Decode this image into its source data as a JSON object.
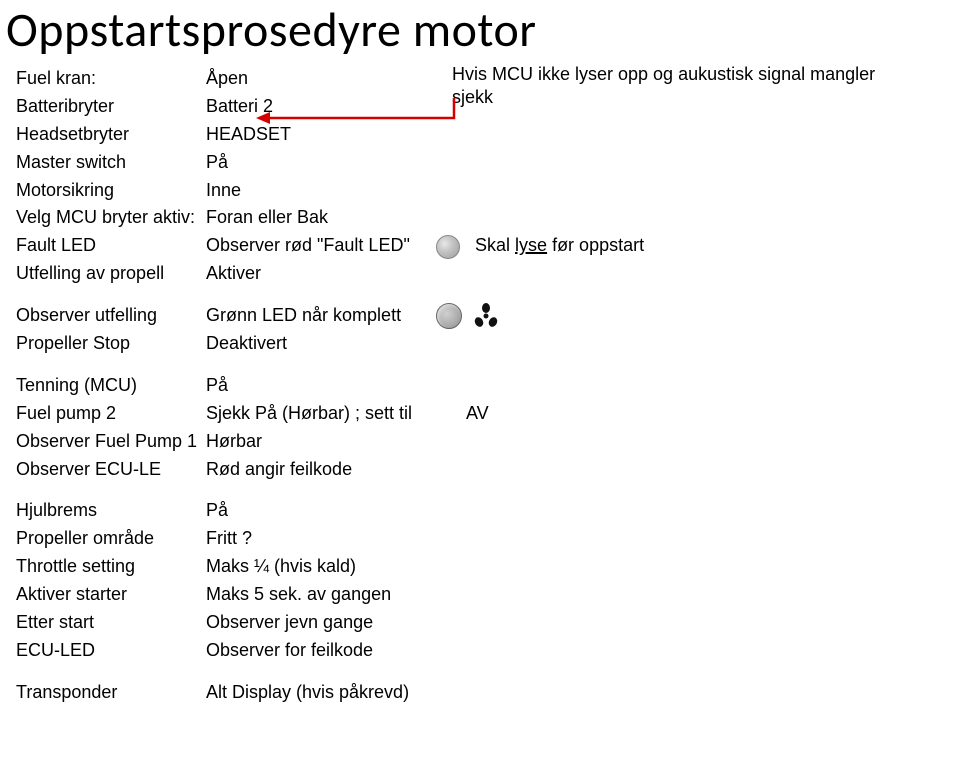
{
  "title": "Oppstartsprosedyre motor",
  "annotation": {
    "line1": "Hvis MCU  ikke lyser opp  og aukustisk signal mangler",
    "line2": "sjekk"
  },
  "group1": [
    {
      "label": "Fuel kran:",
      "value": "Åpen",
      "note": ""
    },
    {
      "label": "Batteribryter",
      "value": "Batteri 2",
      "note": ""
    },
    {
      "label": "Headsetbryter",
      "value": "HEADSET",
      "note": ""
    },
    {
      "label": "Master switch",
      "value": "På",
      "note": ""
    },
    {
      "label": "Motorsikring",
      "value": "Inne",
      "note": ""
    },
    {
      "label": "Velg MCU bryter aktiv:",
      "value": "Foran eller Bak",
      "note": ""
    },
    {
      "label": "Fault LED",
      "value": "Observer rød \"Fault LED\"",
      "note_prefix": "Skal ",
      "note_underline": "lyse",
      "note_suffix": " før oppstart"
    },
    {
      "label": "Utfelling av propell",
      "value": "Aktiver",
      "note": ""
    }
  ],
  "group2": [
    {
      "label": "Observer utfelling",
      "value": "Grønn LED når komplett"
    },
    {
      "label": "Propeller Stop",
      "value": "Deaktivert"
    }
  ],
  "group3": [
    {
      "label": "Tenning (MCU)",
      "value": "På",
      "note": ""
    },
    {
      "label": "Fuel pump 2",
      "value": "Sjekk På (Hørbar) ; sett til",
      "note": "AV"
    },
    {
      "label": "Observer Fuel Pump 1",
      "value": "Hørbar",
      "note": ""
    },
    {
      "label": "Observer ECU-LE",
      "value": "Rød angir feilkode",
      "note": ""
    }
  ],
  "group4": [
    {
      "label": "Hjulbrems",
      "value": "På"
    },
    {
      "label": "Propeller område",
      "value": "Fritt ?"
    },
    {
      "label": "Throttle setting",
      "value": "Maks ¼ (hvis kald)"
    },
    {
      "label": "Aktiver starter",
      "value": "Maks 5 sek. av gangen"
    },
    {
      "label": "Etter start",
      "value": "Observer jevn gange"
    },
    {
      "label": "ECU-LED",
      "value": "Observer for feilkode"
    }
  ],
  "group5": [
    {
      "label": "Transponder",
      "value": "Alt Display (hvis påkrevd)"
    }
  ]
}
